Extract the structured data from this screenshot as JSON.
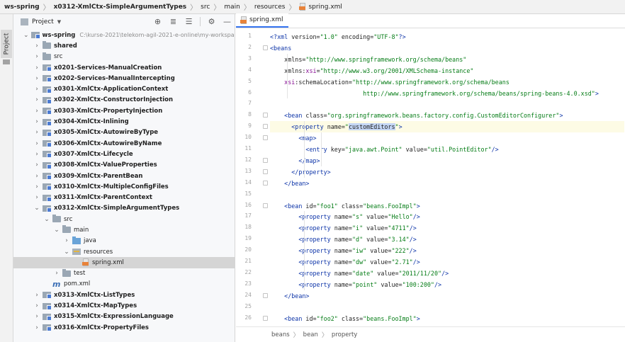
{
  "breadcrumb": [
    "ws-spring",
    "x0312-XmlCtx-SimpleArgumentTypes",
    "src",
    "main",
    "resources",
    "spring.xml"
  ],
  "stripe": {
    "label": "Project"
  },
  "panel": {
    "title": "Project",
    "tools": [
      "crosshair-icon",
      "expand-all-icon",
      "collapse-all-icon",
      "gear-icon",
      "hide-icon"
    ]
  },
  "tree": [
    {
      "label": "ws-spring",
      "bold": true,
      "indent": 0,
      "chev": "down",
      "icon": "module",
      "path": "C:\\kurse-2021\\telekom-agil-2021-e-online\\my-workspace\\blocks"
    },
    {
      "label": "shared",
      "bold": true,
      "indent": 1,
      "chev": "right",
      "icon": "folder"
    },
    {
      "label": "src",
      "bold": false,
      "indent": 1,
      "chev": "right",
      "icon": "folder"
    },
    {
      "label": "x0201-Services-ManualCreation",
      "bold": true,
      "indent": 1,
      "chev": "right",
      "icon": "module"
    },
    {
      "label": "x0202-Services-ManualIntercepting",
      "bold": true,
      "indent": 1,
      "chev": "right",
      "icon": "module"
    },
    {
      "label": "x0301-XmlCtx-ApplicationContext",
      "bold": true,
      "indent": 1,
      "chev": "right",
      "icon": "module"
    },
    {
      "label": "x0302-XmlCtx-ConstructorInjection",
      "bold": true,
      "indent": 1,
      "chev": "right",
      "icon": "module"
    },
    {
      "label": "x0303-XmlCtx-PropertyInjection",
      "bold": true,
      "indent": 1,
      "chev": "right",
      "icon": "module"
    },
    {
      "label": "x0304-XmlCtx-Inlining",
      "bold": true,
      "indent": 1,
      "chev": "right",
      "icon": "module"
    },
    {
      "label": "x0305-XmlCtx-AutowireByType",
      "bold": true,
      "indent": 1,
      "chev": "right",
      "icon": "module"
    },
    {
      "label": "x0306-XmlCtx-AutowireByName",
      "bold": true,
      "indent": 1,
      "chev": "right",
      "icon": "module"
    },
    {
      "label": "x0307-XmlCtx-Lifecycle",
      "bold": true,
      "indent": 1,
      "chev": "right",
      "icon": "module"
    },
    {
      "label": "x0308-XmlCtx-ValueProperties",
      "bold": true,
      "indent": 1,
      "chev": "right",
      "icon": "module"
    },
    {
      "label": "x0309-XmlCtx-ParentBean",
      "bold": true,
      "indent": 1,
      "chev": "right",
      "icon": "module"
    },
    {
      "label": "x0310-XmlCtx-MultipleConfigFiles",
      "bold": true,
      "indent": 1,
      "chev": "right",
      "icon": "module"
    },
    {
      "label": "x0311-XmlCtx-ParentContext",
      "bold": true,
      "indent": 1,
      "chev": "right",
      "icon": "module"
    },
    {
      "label": "x0312-XmlCtx-SimpleArgumentTypes",
      "bold": true,
      "indent": 1,
      "chev": "down",
      "icon": "module"
    },
    {
      "label": "src",
      "bold": false,
      "indent": 2,
      "chev": "down",
      "icon": "folder"
    },
    {
      "label": "main",
      "bold": false,
      "indent": 3,
      "chev": "down",
      "icon": "folder"
    },
    {
      "label": "java",
      "bold": false,
      "indent": 4,
      "chev": "right",
      "icon": "src"
    },
    {
      "label": "resources",
      "bold": false,
      "indent": 4,
      "chev": "down",
      "icon": "res"
    },
    {
      "label": "spring.xml",
      "bold": false,
      "indent": 5,
      "chev": "none",
      "icon": "xml",
      "selected": true
    },
    {
      "label": "test",
      "bold": false,
      "indent": 3,
      "chev": "right",
      "icon": "folder"
    },
    {
      "label": "pom.xml",
      "bold": false,
      "indent": 2,
      "chev": "none",
      "icon": "maven"
    },
    {
      "label": "x0313-XmlCtx-ListTypes",
      "bold": true,
      "indent": 1,
      "chev": "right",
      "icon": "module"
    },
    {
      "label": "x0314-XmlCtx-MapTypes",
      "bold": true,
      "indent": 1,
      "chev": "right",
      "icon": "module"
    },
    {
      "label": "x0315-XmlCtx-ExpressionLanguage",
      "bold": true,
      "indent": 1,
      "chev": "right",
      "icon": "module"
    },
    {
      "label": "x0316-XmlCtx-PropertyFiles",
      "bold": true,
      "indent": 1,
      "chev": "right",
      "icon": "module"
    }
  ],
  "editor": {
    "tab_label": "spring.xml",
    "lines": [
      {
        "n": "1",
        "tokens": [
          [
            "tg",
            "<?xml "
          ],
          [
            "an",
            "version="
          ],
          [
            "vl",
            "\"1.0\""
          ],
          [
            "an",
            " encoding="
          ],
          [
            "vl",
            "\"UTF-8\""
          ],
          [
            "tg",
            "?>"
          ]
        ]
      },
      {
        "n": "2",
        "fold": true,
        "tokens": [
          [
            "tg",
            "<beans"
          ]
        ]
      },
      {
        "n": "3",
        "tokens": [
          [
            "an",
            "    xmlns="
          ],
          [
            "vl",
            "\"http://www.springframework.org/schema/beans\""
          ]
        ]
      },
      {
        "n": "4",
        "tokens": [
          [
            "an",
            "    xmlns:"
          ],
          [
            "ns",
            "xsi"
          ],
          [
            "an",
            "="
          ],
          [
            "vl",
            "\"http://www.w3.org/2001/XMLSchema-instance\""
          ]
        ]
      },
      {
        "n": "5",
        "tokens": [
          [
            "ns",
            "    xsi"
          ],
          [
            "an",
            ":schemaLocation="
          ],
          [
            "vl",
            "\"http://www.springframework.org/schema/beans"
          ]
        ]
      },
      {
        "n": "6",
        "tokens": [
          [
            "vl",
            "                          http://www.springframework.org/schema/beans/spring-beans-4.0.xsd\""
          ],
          [
            "tg",
            ">"
          ]
        ]
      },
      {
        "n": "7",
        "tokens": []
      },
      {
        "n": "8",
        "fold": true,
        "tokens": [
          [
            "tg",
            "    <bean "
          ],
          [
            "an",
            "class="
          ],
          [
            "vl",
            "\"org.springframework.beans.factory.config.CustomEditorConfigurer\""
          ],
          [
            "tg",
            ">"
          ]
        ]
      },
      {
        "n": "9",
        "fold": true,
        "hl": true,
        "tokens": [
          [
            "tg",
            "      <property "
          ],
          [
            "an",
            "name="
          ],
          [
            "vl",
            "\""
          ],
          [
            "mark",
            "customEditors"
          ],
          [
            "vl",
            "\""
          ],
          [
            "tg",
            ">"
          ]
        ]
      },
      {
        "n": "10",
        "fold": true,
        "tokens": [
          [
            "tg",
            "        <map>"
          ]
        ]
      },
      {
        "n": "11",
        "tokens": [
          [
            "tg",
            "          <entry "
          ],
          [
            "an",
            "key="
          ],
          [
            "vl",
            "\"java.awt.Point\""
          ],
          [
            "an",
            " value="
          ],
          [
            "vl",
            "\"util.PointEditor\""
          ],
          [
            "tg",
            "/>"
          ]
        ]
      },
      {
        "n": "12",
        "fold": true,
        "tokens": [
          [
            "tg",
            "        </map>"
          ]
        ]
      },
      {
        "n": "13",
        "fold": true,
        "tokens": [
          [
            "tg",
            "      </property>"
          ]
        ]
      },
      {
        "n": "14",
        "fold": true,
        "tokens": [
          [
            "tg",
            "    </bean>"
          ]
        ]
      },
      {
        "n": "15",
        "tokens": []
      },
      {
        "n": "16",
        "fold": true,
        "tokens": [
          [
            "tg",
            "    <bean "
          ],
          [
            "an",
            "id="
          ],
          [
            "vl",
            "\"foo1\""
          ],
          [
            "an",
            " class="
          ],
          [
            "vl",
            "\"beans.FooImpl\""
          ],
          [
            "tg",
            ">"
          ]
        ]
      },
      {
        "n": "17",
        "tokens": [
          [
            "tg",
            "        <property "
          ],
          [
            "an",
            "name="
          ],
          [
            "vl",
            "\"s\""
          ],
          [
            "an",
            " value="
          ],
          [
            "vl",
            "\"Hello\""
          ],
          [
            "tg",
            "/>"
          ]
        ]
      },
      {
        "n": "18",
        "tokens": [
          [
            "tg",
            "        <property "
          ],
          [
            "an",
            "name="
          ],
          [
            "vl",
            "\"i\""
          ],
          [
            "an",
            " value="
          ],
          [
            "vl",
            "\"4711\""
          ],
          [
            "tg",
            "/>"
          ]
        ]
      },
      {
        "n": "19",
        "tokens": [
          [
            "tg",
            "        <property "
          ],
          [
            "an",
            "name="
          ],
          [
            "vl",
            "\"d\""
          ],
          [
            "an",
            " value="
          ],
          [
            "vl",
            "\"3.14\""
          ],
          [
            "tg",
            "/>"
          ]
        ]
      },
      {
        "n": "20",
        "tokens": [
          [
            "tg",
            "        <property "
          ],
          [
            "an",
            "name="
          ],
          [
            "vl",
            "\"iw\""
          ],
          [
            "an",
            " value="
          ],
          [
            "vl",
            "\"222\""
          ],
          [
            "tg",
            "/>"
          ]
        ]
      },
      {
        "n": "21",
        "tokens": [
          [
            "tg",
            "        <property "
          ],
          [
            "an",
            "name="
          ],
          [
            "vl",
            "\"dw\""
          ],
          [
            "an",
            " value="
          ],
          [
            "vl",
            "\"2.71\""
          ],
          [
            "tg",
            "/>"
          ]
        ]
      },
      {
        "n": "22",
        "tokens": [
          [
            "tg",
            "        <property "
          ],
          [
            "an",
            "name="
          ],
          [
            "vl",
            "\"date\""
          ],
          [
            "an",
            " value="
          ],
          [
            "vl",
            "\"2011/11/20\""
          ],
          [
            "tg",
            "/>"
          ]
        ]
      },
      {
        "n": "23",
        "tokens": [
          [
            "tg",
            "        <property "
          ],
          [
            "an",
            "name="
          ],
          [
            "vl",
            "\"point\""
          ],
          [
            "an",
            " value="
          ],
          [
            "vl",
            "\"100:200\""
          ],
          [
            "tg",
            "/>"
          ]
        ]
      },
      {
        "n": "24",
        "fold": true,
        "tokens": [
          [
            "tg",
            "    </bean>"
          ]
        ]
      },
      {
        "n": "25",
        "tokens": []
      },
      {
        "n": "26",
        "fold": true,
        "tokens": [
          [
            "tg",
            "    <bean "
          ],
          [
            "an",
            "id="
          ],
          [
            "vl",
            "\"foo2\""
          ],
          [
            "an",
            " class="
          ],
          [
            "vl",
            "\"beans.FooImpl\""
          ],
          [
            "tg",
            ">"
          ]
        ]
      }
    ]
  },
  "bottom_crumbs": [
    "beans",
    "bean",
    "property"
  ],
  "colors": {
    "tag": "#0d34a8",
    "value": "#067d17",
    "namespace": "#871094",
    "accent": "#3574f0",
    "selection": "#d5d5d5",
    "current_line": "#fdfbe5"
  }
}
